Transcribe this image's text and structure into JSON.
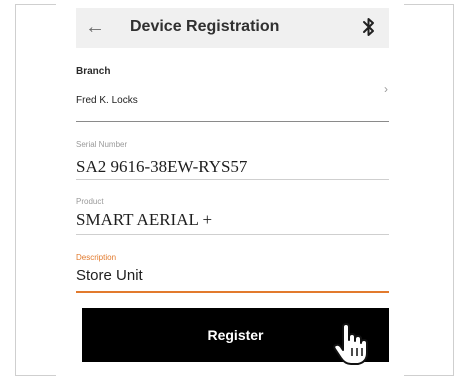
{
  "appbar": {
    "title": "Device Registration",
    "back_icon": "back-arrow-icon",
    "bluetooth_icon": "bluetooth-icon"
  },
  "form": {
    "branch": {
      "label": "Branch",
      "value": "Fred K. Locks"
    },
    "serial_number": {
      "label": "Serial Number",
      "value": "SA2 9616-38EW-RYS57"
    },
    "product": {
      "label": "Product",
      "value": "SMART AERIAL +"
    },
    "description": {
      "label": "Description",
      "value": "Store Unit"
    }
  },
  "actions": {
    "register_label": "Register"
  },
  "colors": {
    "accent": "#e27a2d",
    "appbar_bg": "#f0f0f0",
    "button_bg": "#000000"
  }
}
